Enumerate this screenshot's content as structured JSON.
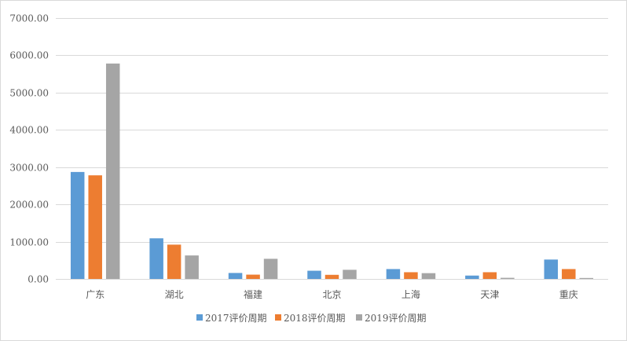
{
  "chart_data": {
    "type": "bar",
    "title": "",
    "xlabel": "",
    "ylabel": "",
    "ylim": [
      0,
      7000
    ],
    "yticks": [
      "0.00",
      "1000.00",
      "2000.00",
      "3000.00",
      "4000.00",
      "5000.00",
      "6000.00",
      "7000.00"
    ],
    "ytick_values": [
      0,
      1000,
      2000,
      3000,
      4000,
      5000,
      6000,
      7000
    ],
    "grid": true,
    "legend_position": "bottom",
    "categories": [
      "广东",
      "湖北",
      "福建",
      "北京",
      "上海",
      "天津",
      "重庆"
    ],
    "series": [
      {
        "name": "2017评价周期",
        "color": "#5B9BD5",
        "values": [
          2870,
          1090,
          160,
          220,
          265,
          90,
          520
        ]
      },
      {
        "name": "2018评价周期",
        "color": "#ED7D31",
        "values": [
          2780,
          920,
          115,
          110,
          180,
          180,
          265
        ]
      },
      {
        "name": "2019评价周期",
        "color": "#A5A5A5",
        "values": [
          5780,
          630,
          540,
          245,
          155,
          30,
          25
        ]
      }
    ],
    "gridline_color": "#d9d9d9",
    "axis_color": "#d9d9d9"
  }
}
